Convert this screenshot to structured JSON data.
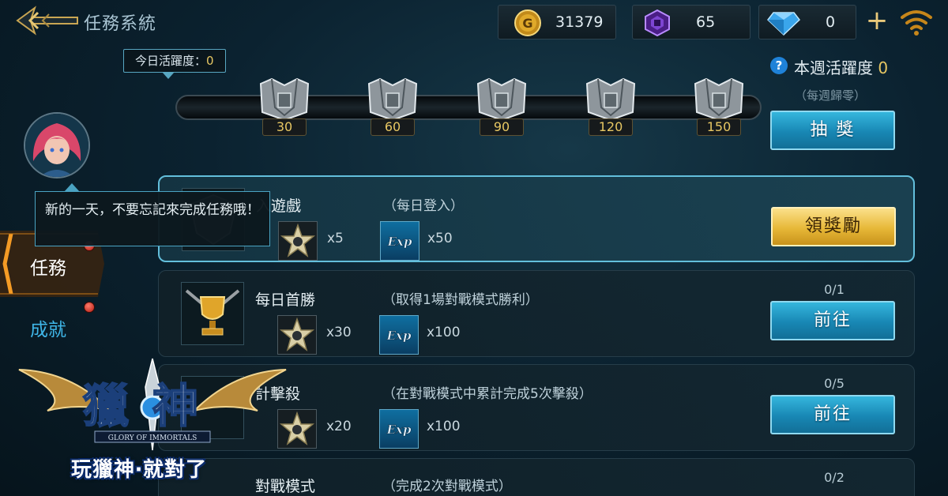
{
  "header": {
    "title": "任務系統",
    "gold": "31379",
    "gems": "65",
    "diamonds": "0",
    "add_label": "+"
  },
  "activity": {
    "today_label": "今日活躍度：",
    "today_value": "0",
    "milestones": [
      "30",
      "60",
      "90",
      "120",
      "150"
    ],
    "weekly_help": "?",
    "weekly_label": "本週活躍度 ",
    "weekly_value": "0",
    "weekly_reset": "（每週歸零）",
    "draw_button": "抽 獎"
  },
  "sidebar": {
    "tooltip": "新的一天，不要忘記來完成任務哦！",
    "tabs": [
      {
        "label": "任務"
      },
      {
        "label": "成就"
      }
    ]
  },
  "tasks": [
    {
      "name": "入遊戲",
      "desc": "（每日登入）",
      "star_qty": "x5",
      "exp_qty": "x50",
      "progress": "",
      "button": "領獎勵",
      "exp_icon": "Exp"
    },
    {
      "name": "每日首勝",
      "desc": "（取得1場對戰模式勝利）",
      "star_qty": "x30",
      "exp_qty": "x100",
      "progress": "0/1",
      "button": "前往",
      "exp_icon": "Exp"
    },
    {
      "name": "計擊殺",
      "desc": "（在對戰模式中累計完成5次擊殺）",
      "star_qty": "x20",
      "exp_qty": "x100",
      "progress": "0/5",
      "button": "前往",
      "exp_icon": "Exp"
    },
    {
      "name": "對戰模式",
      "desc": "（完成2次對戰模式）",
      "star_qty": "",
      "exp_qty": "",
      "progress": "0/2",
      "button": "",
      "exp_icon": ""
    }
  ],
  "logo": {
    "name": "獵神",
    "subtitle": "GLORY OF IMMORTALS",
    "slogan": "玩獵神‧就對了"
  }
}
